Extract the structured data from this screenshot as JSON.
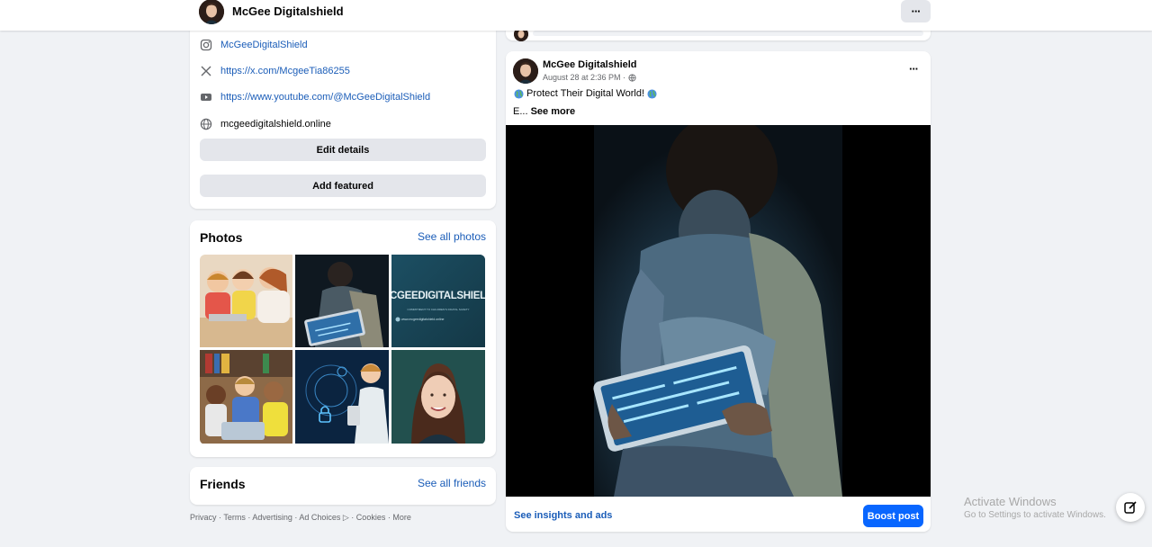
{
  "header": {
    "page_name": "McGee Digitalshield",
    "more_label": "···"
  },
  "intro": {
    "items": [
      {
        "icon": "instagram-icon",
        "text": "McGeeDigitalShield",
        "kind": "link"
      },
      {
        "icon": "x-icon",
        "text": "https://x.com/McgeeTia86255",
        "kind": "link"
      },
      {
        "icon": "youtube-icon",
        "text": "https://www.youtube.com/@McGeeDigitalShield",
        "kind": "link"
      },
      {
        "icon": "globe-icon",
        "text": "mcgeedigitalshield.online",
        "kind": "plain"
      }
    ],
    "edit_details": "Edit details",
    "add_featured": "Add featured"
  },
  "photos": {
    "title": "Photos",
    "see_all": "See all photos",
    "logo_text": "CGEEDIGITALSHIELD",
    "logo_sub": "COMMITMENT TO CHILDREN'S DIGITAL SAFETY",
    "logo_url": "www.mcgeedigitalshield.online"
  },
  "friends": {
    "title": "Friends",
    "see_all": "See all friends"
  },
  "footer": {
    "links": "Privacy · Terms · Advertising · Ad Choices ▷ · Cookies · More"
  },
  "post": {
    "author": "McGee Digitalshield",
    "timestamp": "August 28 at 2:36 PM ·",
    "text_line1": "Protect Their Digital World!",
    "text_line2_prefix": "E... ",
    "see_more": "See more",
    "insights": "See insights and ads",
    "boost": "Boost post"
  },
  "watermark": {
    "line1": "Activate Windows",
    "line2": "Go to Settings to activate Windows."
  },
  "colors": {
    "link": "#1b5db8",
    "primary": "#0866ff",
    "page_bg": "#f0f2f5"
  }
}
